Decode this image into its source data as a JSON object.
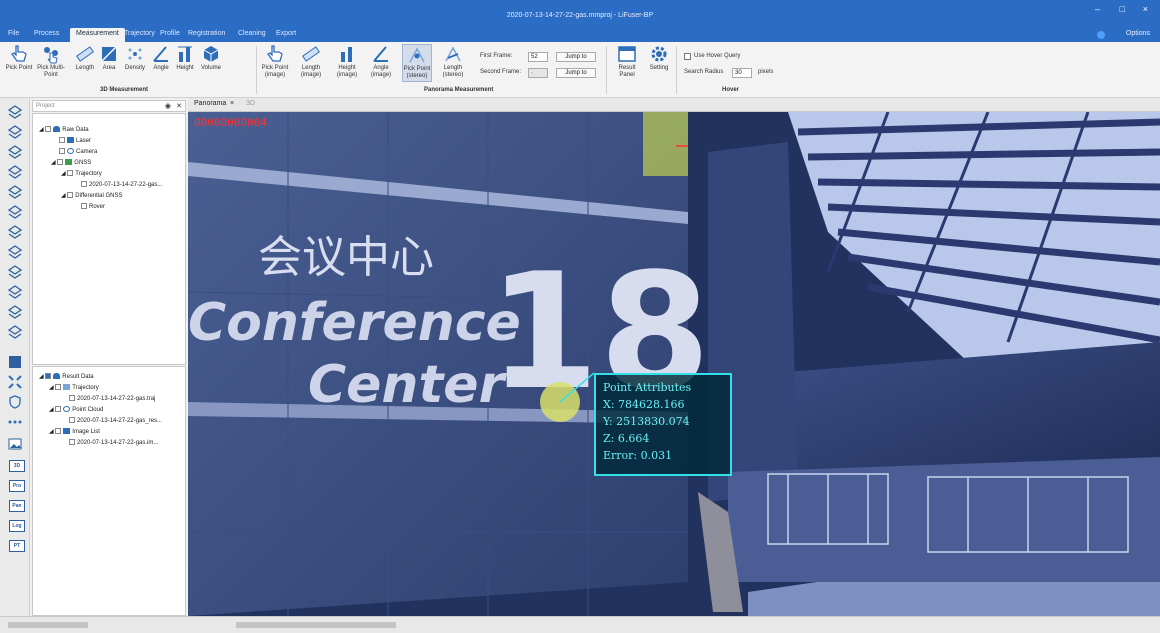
{
  "window": {
    "title": "2020-07-13-14-27-22-gas.mmproj - LiFuser-BP",
    "controls": [
      "–",
      "□",
      "×"
    ]
  },
  "menu": {
    "items": [
      "File",
      "Process",
      "Measurement",
      "Trajectory",
      "Profile",
      "Registration",
      "Cleaning",
      "Export"
    ],
    "active": "Measurement",
    "options_label": "Options"
  },
  "ribbon": {
    "group_3d": "3D Measurement",
    "group_pano": "Panorama Measurement",
    "group_hover": "Hover",
    "b_pick_point": "Pick Point",
    "b_pick_multi": "Pick Multi-Point",
    "b_length": "Length",
    "b_area": "Area",
    "b_density": "Density",
    "b_angle": "Angle",
    "b_height": "Height",
    "b_volume": "Volume",
    "b_pick_image": "Pick Point (image)",
    "b_length_image": "Length (image)",
    "b_height_image": "Height (image)",
    "b_angle_image": "Angle (image)",
    "b_pick_stereo": "Pick Point (stereo)",
    "b_length_stereo": "Length (stereo)",
    "first_frame_label": "First Frame:",
    "first_frame_value": "52",
    "second_frame_label": "Second Frame:",
    "second_frame_value": "-",
    "jump_label": "Jump to",
    "b_result_panel": "Result Panel",
    "b_setting": "Setting",
    "hover_query_label": "Use Hover Query",
    "search_radius_label": "Search Radius",
    "search_radius_value": "30",
    "pixels_label": "pixels"
  },
  "left_panel": {
    "search_placeholder": "Project",
    "tree_top": [
      {
        "label": "Raw Data",
        "level": 0
      },
      {
        "label": "Laser",
        "level": 1
      },
      {
        "label": "Camera",
        "level": 1
      },
      {
        "label": "GNSS",
        "level": 1
      },
      {
        "label": "Trajectory",
        "level": 2
      },
      {
        "label": "2020-07-13-14-27-22-gas...",
        "level": 3
      },
      {
        "label": "Differential GNSS",
        "level": 2
      },
      {
        "label": "Rover",
        "level": 3
      }
    ],
    "tree_bottom": [
      {
        "label": "Result Data",
        "level": 0
      },
      {
        "label": "Trajectory",
        "level": 1
      },
      {
        "label": "2020-07-13-14-27-22-gas.traj",
        "level": 2
      },
      {
        "label": "Point Cloud",
        "level": 1
      },
      {
        "label": "2020-07-13-14-27-22-gas_res...",
        "level": 2
      },
      {
        "label": "Image List",
        "level": 1
      },
      {
        "label": "2020-07-13-14-27-22-gas.im...",
        "level": 2
      }
    ],
    "side_tool_labels": [
      "3D",
      "Pro",
      "Pan",
      "Log",
      "PT"
    ]
  },
  "tabs": {
    "panorama": "Panorama",
    "close": "×",
    "secondary": "3D"
  },
  "scene": {
    "chinese_sign": "会议中心",
    "sign_line1": "Conference",
    "sign_line2": "Center",
    "sign_number": "18",
    "frame_id": "00000000004"
  },
  "point_attributes": {
    "title": "Point Attributes",
    "x": "X: 784628.166",
    "y": "Y: 2513830.074",
    "z": "Z: 6.664",
    "error": "Error: 0.031"
  },
  "colors": {
    "titlebar": "#2b6cc4",
    "accent_cyan": "#33e0e8",
    "ribbon_bg": "#f3f3f3"
  }
}
